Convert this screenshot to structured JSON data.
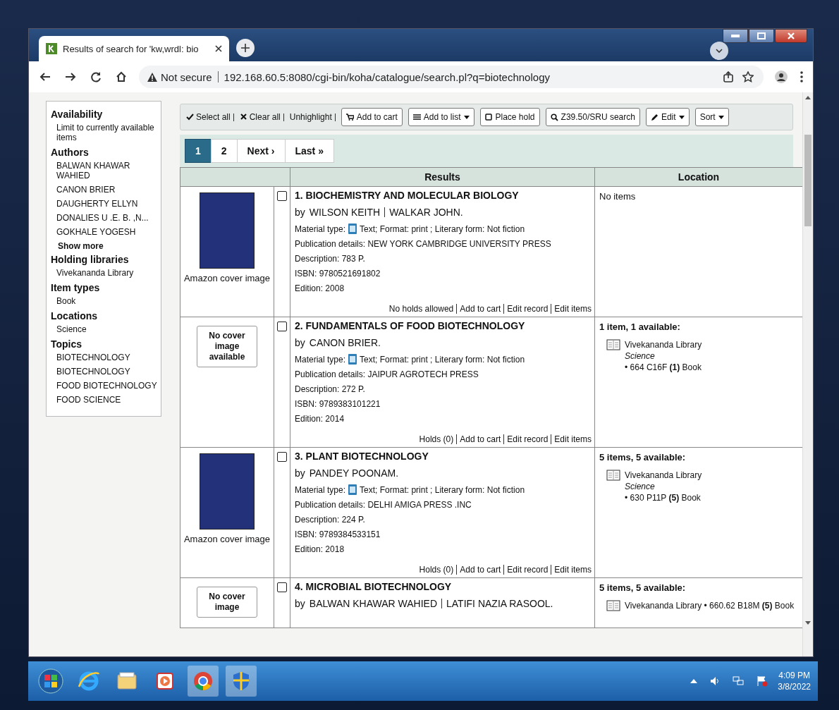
{
  "browser": {
    "tab_title": "Results of search for 'kw,wrdl: bio",
    "security": "Not secure",
    "url": "192.168.60.5:8080/cgi-bin/koha/catalogue/search.pl?q=biotechnology"
  },
  "facets": [
    {
      "title": "Availability",
      "items": [
        "Limit to currently available items"
      ]
    },
    {
      "title": "Authors",
      "items": [
        "BALWAN KHAWAR WAHIED",
        "CANON BRIER",
        "DAUGHERTY ELLYN",
        "DONALIES U .E. B. ,N...",
        "GOKHALE YOGESH"
      ],
      "show_more": "Show more"
    },
    {
      "title": "Holding libraries",
      "items": [
        "Vivekananda Library"
      ]
    },
    {
      "title": "Item types",
      "items": [
        "Book"
      ]
    },
    {
      "title": "Locations",
      "items": [
        "Science"
      ]
    },
    {
      "title": "Topics",
      "items": [
        "BIOTECHNOLOGY",
        "BIOTECHNOLOGY",
        "FOOD BIOTECHNOLOGY",
        "FOOD SCIENCE"
      ]
    }
  ],
  "toolbar": {
    "links": [
      {
        "label": "Select all",
        "kind": "select"
      },
      {
        "label": "Clear all",
        "kind": "clear"
      },
      {
        "label": "Unhighlight",
        "kind": "plain"
      }
    ],
    "buttons": [
      {
        "label": "Add to cart",
        "kind": "cart",
        "dropdown": false
      },
      {
        "label": "Add to list",
        "kind": "list",
        "dropdown": true
      },
      {
        "label": "Place hold",
        "kind": "hold",
        "dropdown": false
      },
      {
        "label": "Z39.50/SRU search",
        "kind": "search",
        "dropdown": false
      },
      {
        "label": "Edit",
        "kind": "edit",
        "dropdown": true
      },
      {
        "label": "Sort",
        "kind": "plain",
        "dropdown": true
      }
    ]
  },
  "pagination": [
    {
      "label": "1",
      "selected": true
    },
    {
      "label": "2",
      "selected": false
    },
    {
      "label": "Next ›",
      "selected": false
    },
    {
      "label": "Last »",
      "selected": false
    }
  ],
  "table": {
    "columns": [
      "Results",
      "Location"
    ],
    "rows": [
      {
        "cover": {
          "kind": "image",
          "caption": "Amazon cover image"
        },
        "checked": false,
        "title": "1. BIOCHEMISTRY AND MOLECULAR BIOLOGY",
        "by": "by",
        "authors": [
          "WILSON KEITH",
          "WALKAR JOHN."
        ],
        "material_label": "Material type:",
        "material": "Text; Format: print ; Literary form: Not fiction",
        "details": [
          "Publication details: NEW YORK CAMBRIDGE UNIVERSITY PRESS",
          "Description: 783 P.",
          "ISBN: 9780521691802",
          "Edition: 2008"
        ],
        "actions": [
          "No holds allowed",
          "Add to cart",
          "Edit record",
          "Edit items"
        ],
        "location": {
          "summary": "No items"
        }
      },
      {
        "cover": {
          "kind": "none",
          "text": "No cover image available"
        },
        "checked": false,
        "title": "2. FUNDAMENTALS OF FOOD BIOTECHNOLOGY",
        "by": "by",
        "authors": [
          "CANON BRIER."
        ],
        "material_label": "Material type:",
        "material": "Text; Format: print ; Literary form: Not fiction",
        "details": [
          "Publication details: JAIPUR AGROTECH PRESS",
          "Description: 272 P.",
          "ISBN: 9789383101221",
          "Edition: 2014"
        ],
        "actions": [
          "Holds (0)",
          "Add to cart",
          "Edit record",
          "Edit items"
        ],
        "location": {
          "summary": "1 item, 1 available:",
          "library": "Vivekananda Library",
          "collection": "Science",
          "call": "• 664 C16F",
          "count": "(1)",
          "type": "Book"
        }
      },
      {
        "cover": {
          "kind": "image",
          "caption": "Amazon cover image"
        },
        "checked": false,
        "title": "3. PLANT BIOTECHNOLOGY",
        "by": "by",
        "authors": [
          "PANDEY POONAM."
        ],
        "material_label": "Material type:",
        "material": "Text; Format: print ; Literary form: Not fiction",
        "details": [
          "Publication details: DELHI AMIGA PRESS .INC",
          "Description: 224 P.",
          "ISBN: 9789384533151",
          "Edition: 2018"
        ],
        "actions": [
          "Holds (0)",
          "Add to cart",
          "Edit record",
          "Edit items"
        ],
        "location": {
          "summary": "5 items, 5 available:",
          "library": "Vivekananda Library",
          "collection": "Science",
          "call": "• 630 P11P",
          "count": "(5)",
          "type": "Book"
        }
      },
      {
        "cover": {
          "kind": "none",
          "text": "No cover image"
        },
        "checked": false,
        "title": "4. MICROBIAL BIOTECHNOLOGY",
        "by": "by",
        "authors": [
          "BALWAN KHAWAR WAHIED",
          "LATIFI NAZIA RASOOL."
        ],
        "location": {
          "summary": "5 items, 5 available:",
          "library": "Vivekananda Library",
          "call": "• 660.62 B18M",
          "count": "(5)",
          "type": "Book"
        }
      }
    ]
  },
  "taskbar": {
    "apps": [
      {
        "kind": "start"
      },
      {
        "kind": "ie"
      },
      {
        "kind": "folder"
      },
      {
        "kind": "media"
      },
      {
        "kind": "chrome"
      },
      {
        "kind": "shield"
      }
    ],
    "time": "4:09 PM",
    "date": "3/8/2022"
  }
}
